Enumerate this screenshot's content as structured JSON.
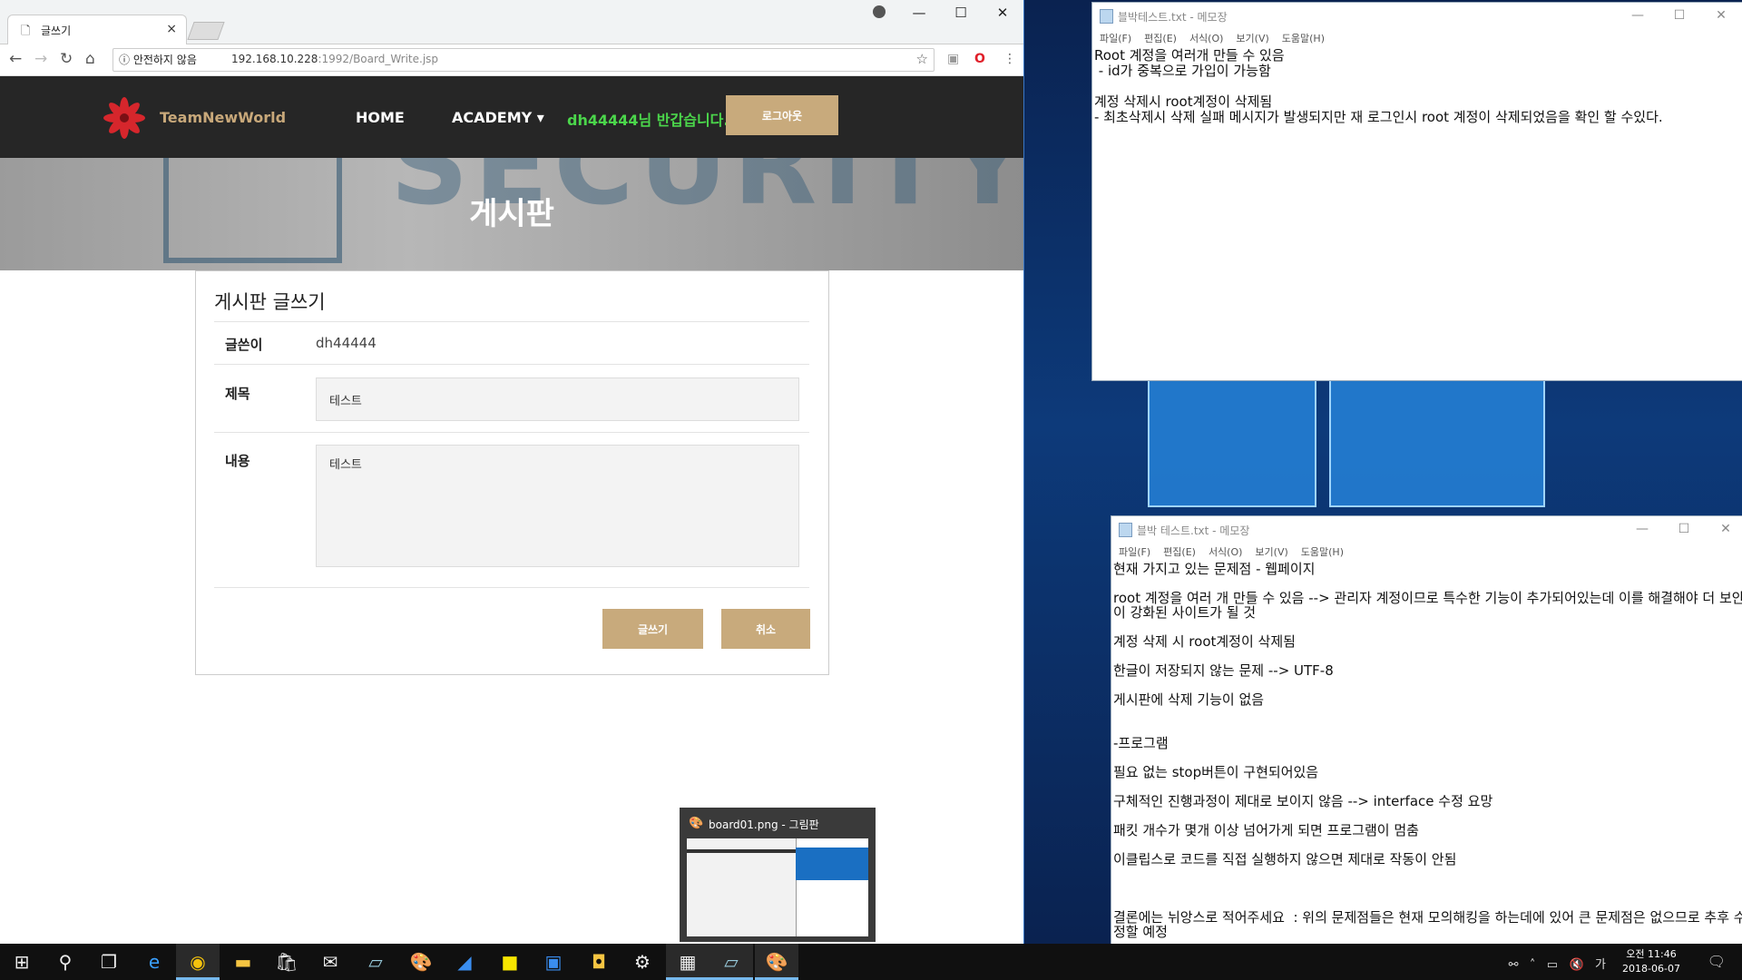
{
  "browser": {
    "tab_title": "글쓰기",
    "tab_close": "×",
    "url_security": "ⓘ 안전하지 않음",
    "url_host": "192.168.10.228",
    "url_path": ":1992/Board_Write.jsp"
  },
  "site": {
    "brand": "TeamNewWorld",
    "nav_home": "HOME",
    "nav_academy": "ACADEMY ▾",
    "welcome": "dh44444님 반갑습니다.",
    "logout": "로그아웃",
    "hero_bg_text": "SECURITY",
    "hero_title": "게시판"
  },
  "form": {
    "title": "게시판 글쓰기",
    "author_label": "글쓴이",
    "author_value": "dh44444",
    "subject_label": "제목",
    "subject_value": "테스트",
    "content_label": "내용",
    "content_value": "테스트",
    "submit": "글쓰기",
    "cancel": "취소"
  },
  "notepad1": {
    "title": "블박테스트.txt - 메모장",
    "menu": [
      "파일(F)",
      "편집(E)",
      "서식(O)",
      "보기(V)",
      "도움말(H)"
    ],
    "lines": [
      "Root 계정을 여러개 만들 수 있음",
      " - id가 중복으로 가입이 가능함",
      "",
      "계정 삭제시 root계정이 삭제됨",
      "- 최초삭제시 삭제 실패 메시지가 발생되지만 재 로그인시 root 계정이 삭제되었음을 확인 할 수있다."
    ]
  },
  "notepad2": {
    "title": "블박 테스트.txt - 메모장",
    "menu": [
      "파일(F)",
      "편집(E)",
      "서식(O)",
      "보기(V)",
      "도움말(H)"
    ],
    "lines": [
      "현재 가지고 있는 문제점 - 웹페이지",
      "",
      "root 계정을 여러 개 만들 수 있음 --> 관리자 계정이므로 특수한 기능이 추가되어있는데 이를 해결해야 더 보안이 강화된 사이트가 될 것",
      "",
      "계정 삭제 시 root계정이 삭제됨",
      "",
      "한글이 저장되지 않는 문제 --> UTF-8",
      "",
      "게시판에 삭제 기능이 없음",
      "",
      "",
      "-프로그램",
      "",
      "필요 없는 stop버튼이 구현되어있음",
      "",
      "구체적인 진행과정이 제대로 보이지 않음 --> interface 수정 요망",
      "",
      "패킷 개수가 몇개 이상 넘어가게 되면 프로그램이 멈춤",
      "",
      "이클립스로 코드를 직접 실행하지 않으면 제대로 작동이 안됨",
      "",
      "",
      "",
      "결론에는 뉘앙스로 적어주세요  : 위의 문제점들은 현재 모의해킹을 하는데에 있어 큰 문제점은 없으므로 추후 수정할 예정"
    ]
  },
  "thumbnail": {
    "title": "board01.png - 그림판"
  },
  "taskbar": {
    "time": "오전 11:46",
    "date": "2018-06-07",
    "ime": "가"
  },
  "colors": {
    "accent": "#c8aa7c",
    "welcome": "#4bd64b",
    "nav_bg": "#262626"
  }
}
